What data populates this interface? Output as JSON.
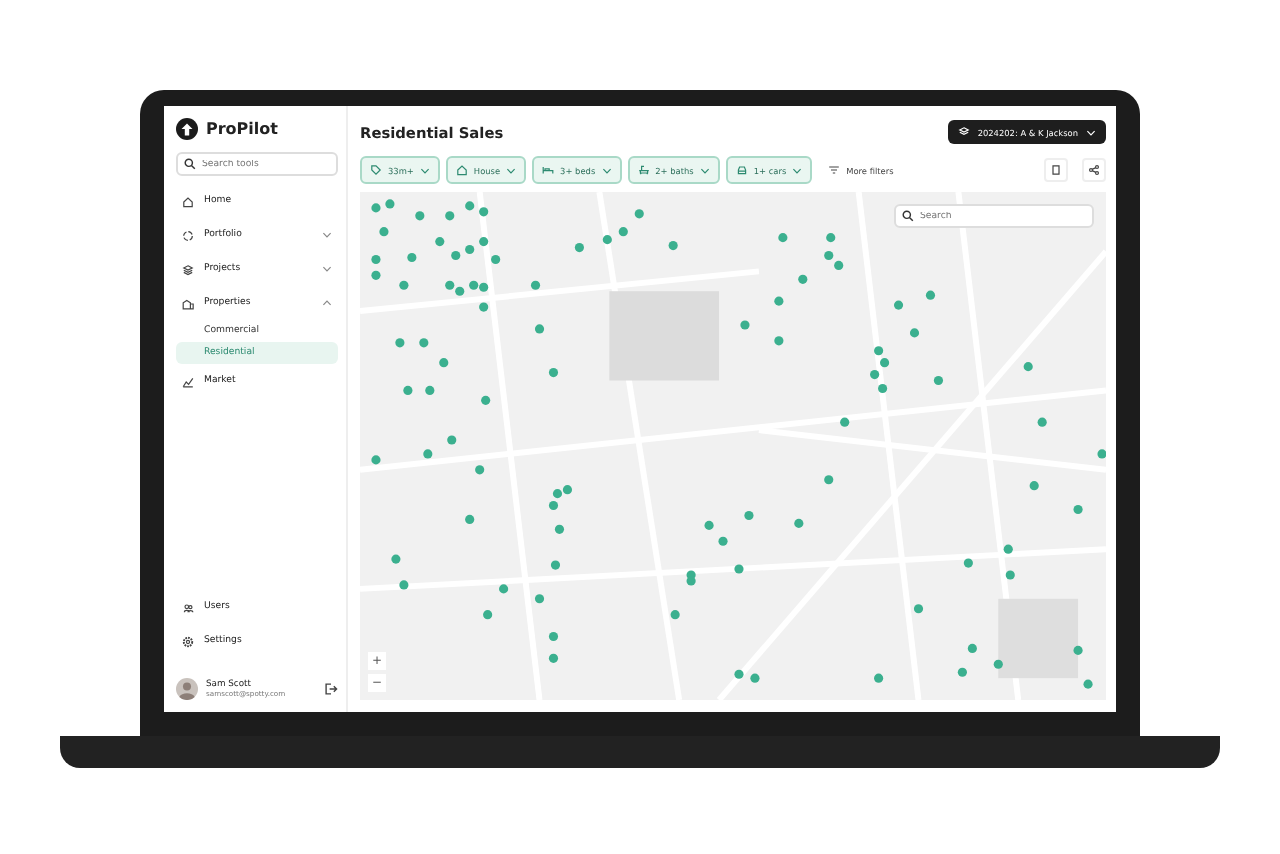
{
  "app": {
    "name": "ProPilot"
  },
  "sidebar": {
    "search": {
      "placeholder": "Search tools"
    },
    "items": [
      {
        "label": "Home",
        "kind": "home"
      },
      {
        "label": "Portfolio",
        "kind": "portfolio",
        "expanded": false
      },
      {
        "label": "Projects",
        "kind": "projects",
        "expanded": false
      },
      {
        "label": "Properties",
        "kind": "properties",
        "expanded": true,
        "children": [
          {
            "label": "Commercial",
            "selected": false
          },
          {
            "label": "Residential",
            "selected": true
          }
        ]
      },
      {
        "label": "Market",
        "kind": "market"
      }
    ],
    "bottom_items": [
      {
        "label": "Users",
        "kind": "users"
      },
      {
        "label": "Settings",
        "kind": "settings"
      }
    ],
    "user": {
      "name": "Sam Scott",
      "email": "samscott@spotty.com"
    }
  },
  "header": {
    "title": "Residential Sales",
    "project": "2024202: A & K Jackson"
  },
  "filters": [
    {
      "label": "33m+",
      "kind": "tag",
      "active": true
    },
    {
      "label": "House",
      "kind": "home",
      "active": true
    },
    {
      "label": "3+ beds",
      "kind": "bed",
      "active": true
    },
    {
      "label": "2+ baths",
      "kind": "bath",
      "active": true
    },
    {
      "label": "1+ cars",
      "kind": "car",
      "active": true
    },
    {
      "label": "More filters",
      "kind": "filter",
      "active": false
    }
  ],
  "map": {
    "search": {
      "placeholder": "Search"
    },
    "zoom_in": "+",
    "zoom_out": "−"
  }
}
